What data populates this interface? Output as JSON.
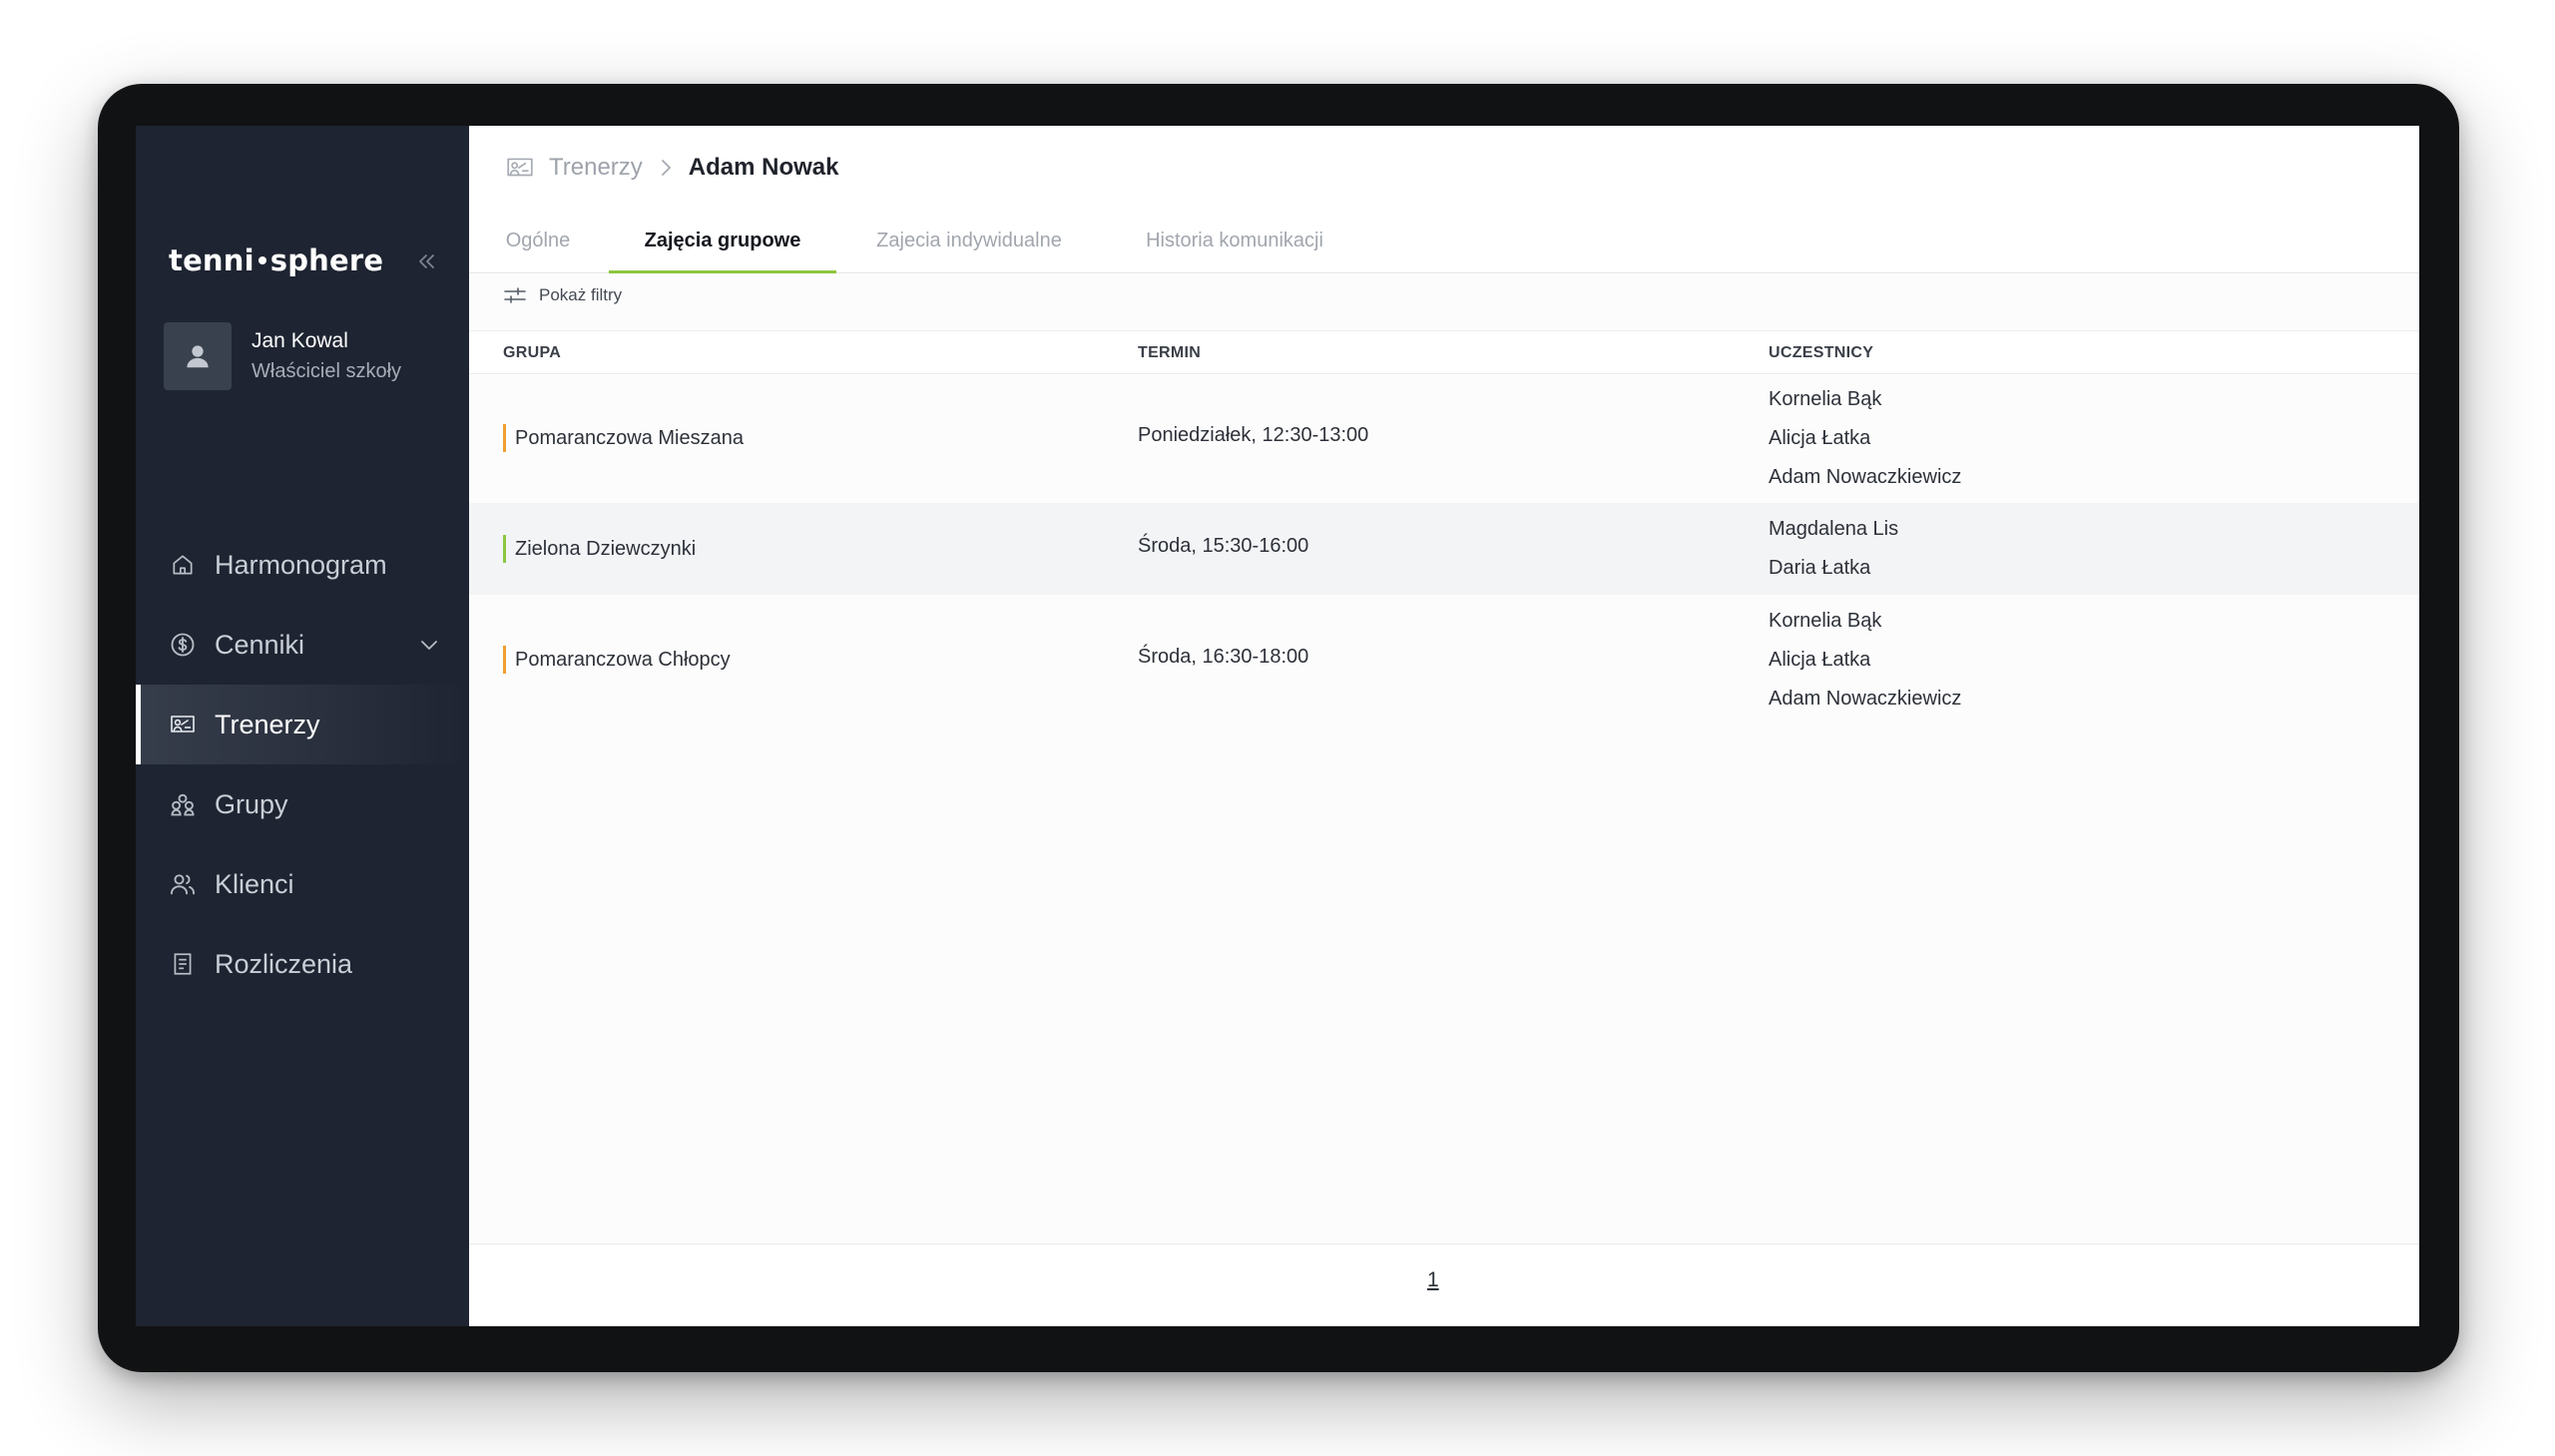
{
  "app": {
    "logo_left": "tenni",
    "logo_right": "sphere"
  },
  "user": {
    "name": "Jan Kowal",
    "role": "Właściciel szkoły"
  },
  "sidebar": {
    "items": [
      {
        "label": "Harmonogram",
        "icon": "home-icon"
      },
      {
        "label": "Cenniki",
        "icon": "dollar-icon"
      },
      {
        "label": "Trenerzy",
        "icon": "trainer-board-icon"
      },
      {
        "label": "Grupy",
        "icon": "group-icon"
      },
      {
        "label": "Klienci",
        "icon": "users-icon"
      },
      {
        "label": "Rozliczenia",
        "icon": "document-icon"
      }
    ],
    "active": "Trenerzy"
  },
  "breadcrumb": {
    "parent": "Trenerzy",
    "current": "Adam Nowak"
  },
  "tabs": [
    {
      "label": "Ogólne"
    },
    {
      "label": "Zajęcia grupowe"
    },
    {
      "label": "Zajecia indywidualne"
    },
    {
      "label": "Historia komunikacji"
    }
  ],
  "active_tab": "Zajęcia grupowe",
  "filters": {
    "label": "Pokaż filtry"
  },
  "table": {
    "headers": [
      "GRUPA",
      "TERMIN",
      "UCZESTNICY"
    ],
    "rows": [
      {
        "group": "Pomaranczowa Mieszana",
        "color": "#f0a030",
        "term": "Poniedziałek, 12:30-13:00",
        "participants": [
          "Kornelia Bąk",
          "Alicja Łatka",
          "Adam Nowaczkiewicz"
        ]
      },
      {
        "group": "Zielona Dziewczynki",
        "color": "#8cc63f",
        "term": "Środa, 15:30-16:00",
        "participants": [
          "Magdalena Lis",
          "Daria Łatka"
        ]
      },
      {
        "group": "Pomaranczowa Chłopcy",
        "color": "#f0a030",
        "term": "Środa, 16:30-18:00",
        "participants": [
          "Kornelia Bąk",
          "Alicja Łatka",
          "Adam Nowaczkiewicz"
        ]
      }
    ]
  },
  "pagination": {
    "current_page": "1"
  }
}
